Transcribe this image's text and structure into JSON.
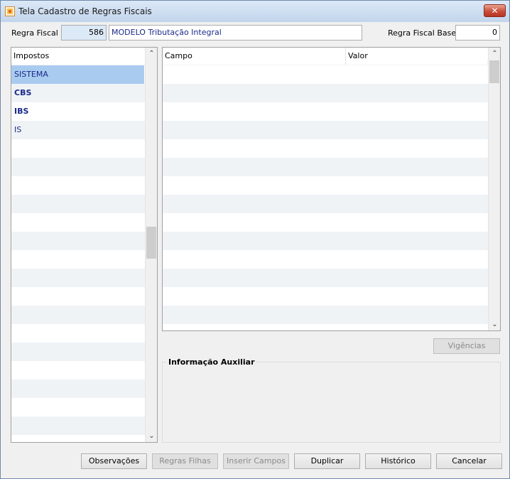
{
  "window": {
    "title": "Tela Cadastro de Regras Fiscais",
    "close_label": "✕"
  },
  "form": {
    "regra_fiscal_label": "Regra Fiscal",
    "regra_fiscal_code": "586",
    "regra_fiscal_desc": "MODELO Tributação Integral",
    "regra_base_label": "Regra Fiscal Base",
    "regra_base_value": "0"
  },
  "impostos": {
    "header": "Impostos",
    "items": [
      {
        "label": "SISTEMA",
        "selected": true,
        "bold": false
      },
      {
        "label": "CBS",
        "selected": false,
        "bold": true
      },
      {
        "label": "IBS",
        "selected": false,
        "bold": true
      },
      {
        "label": "IS",
        "selected": false,
        "bold": false
      }
    ]
  },
  "grid": {
    "col_campo": "Campo",
    "col_valor": "Valor"
  },
  "vigencias_label": "Vigências",
  "info_aux_title": "Informação Auxiliar",
  "buttons": {
    "observacoes": "Observações",
    "regras_filhas": "Regras Filhas",
    "inserir_campos": "Inserir Campos",
    "duplicar": "Duplicar",
    "historico": "Histórico",
    "cancelar": "Cancelar"
  },
  "colors": {
    "selected_row": "#aacbf0",
    "item_text": "#1a2a8a",
    "code_field_bg": "#dce9f7"
  }
}
